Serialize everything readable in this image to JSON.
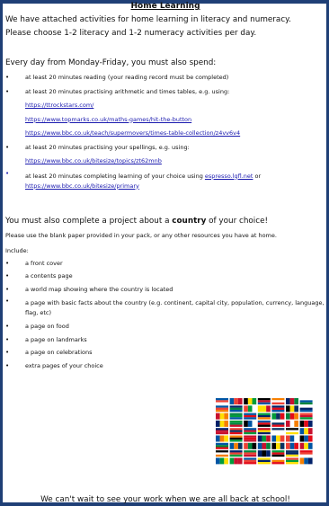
{
  "title": "Home Learning",
  "intro": [
    "We have attached activities for home learning in literacy and numeracy.",
    "Please choose 1-2 literacy and 1-2 numeracy activities per day."
  ],
  "every_day_lead": "Every day from Monday-Friday, you must also spend:",
  "tasks": [
    {
      "text": "at least 20 minutes reading (your reading record must be completed)",
      "links": []
    },
    {
      "text": "at least 20 minutes practising arithmetic and times tables, e.g. using:",
      "links": [
        "https://ttrockstars.com/",
        "https://www.topmarks.co.uk/maths-games/hit-the-button",
        "https://www.bbc.co.uk/teach/supermovers/times-table-collection/z4vv6v4"
      ]
    },
    {
      "text": "at least 20 minutes practising your spellings, e.g. using:",
      "links": [
        "https://www.bbc.co.uk/bitesize/topics/zt62mnb"
      ]
    }
  ],
  "choice_task": {
    "text_before": "at least 20 minutes completing learning of your choice using ",
    "link1": "espresso.lgfl.net",
    "text_mid": " or",
    "link2": "https://www.bbc.co.uk/bitesize/primary"
  },
  "project_lead": {
    "before": "You must also complete a project about a ",
    "bold": "country",
    "after": " of your choice!"
  },
  "project_note": "Please use the blank paper provided in your pack, or any other resources you have at home.",
  "include_label": "Include:",
  "include_items": [
    "a front cover",
    "a contents page",
    "a world map showing where the country is located",
    "a page with basic facts about the country (e.g. continent, capital city, population, currency, language, flag, etc)",
    "a page on food",
    "a page on landmarks",
    "a page on celebrations",
    "extra pages of your choice"
  ],
  "footer": "We can't wait to see your work when we are all back at school!",
  "bullet": "•",
  "colors": {
    "border": "#1f3f76",
    "link": "#1a1aaf"
  },
  "image_icon": "world-flags-icon"
}
